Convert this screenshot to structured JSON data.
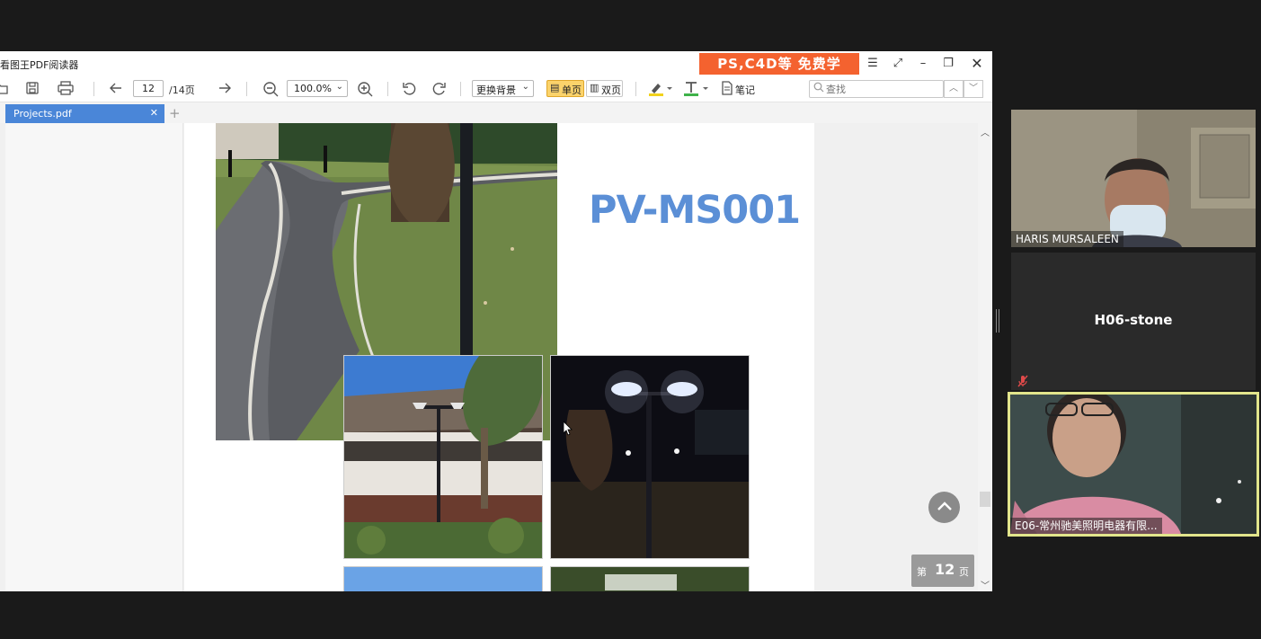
{
  "window": {
    "title": "看图王PDF阅读器",
    "ad_banner": "PS,C4D等 免费学",
    "menu_icon": "hamburger-icon",
    "fullscreen_icon": "expand-icon",
    "minimize_icon": "minimize-icon",
    "restore_icon": "restore-icon",
    "close_icon": "close-icon"
  },
  "toolbar": {
    "open_icon": "folder-icon",
    "save_icon": "save-icon",
    "print_icon": "print-icon",
    "prev_icon": "arrow-left-icon",
    "page_current": "12",
    "page_total": "/14页",
    "next_icon": "arrow-right-icon",
    "zoom_out_icon": "zoom-out-icon",
    "zoom": "100.0%",
    "zoom_in_icon": "zoom-in-icon",
    "undo_icon": "rotate-left-icon",
    "redo_icon": "rotate-right-icon",
    "background": "更换背景",
    "single_page": "单页",
    "double_page": "双页",
    "highlight_icon": "highlighter-icon",
    "text_icon": "text-color-icon",
    "notes": "笔记",
    "search_placeholder": "查找",
    "search_value": ""
  },
  "tabs": [
    {
      "label": "Projects.pdf",
      "active": true
    }
  ],
  "document": {
    "product_title": "PV-MS001",
    "page_badge_prefix": "第",
    "page_badge_number": "12",
    "page_badge_suffix": "页"
  },
  "participants": [
    {
      "name": "HARIS MURSALEEN",
      "video": true
    },
    {
      "name": "H06-stone",
      "video": false,
      "muted": true
    },
    {
      "name": "E06-常州驰美照明电器有限...",
      "video": true,
      "speaking": true
    }
  ],
  "colors": {
    "accent_tab": "#4a86d8",
    "product_title": "#5b8fd6",
    "ad_banner": "#f4622f",
    "speaking_border": "#e2e58c",
    "active_mode": "#fbd36b"
  }
}
